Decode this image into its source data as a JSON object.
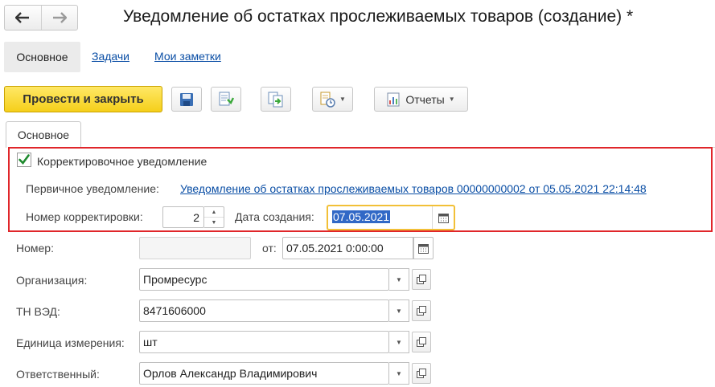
{
  "window": {
    "title": "Уведомление об остатках прослеживаемых товаров (создание) *"
  },
  "nav": {
    "back_icon": "arrow-left-icon",
    "forward_icon": "arrow-right-icon"
  },
  "section_tabs": [
    {
      "label": "Основное",
      "active": true
    },
    {
      "label": "Задачи",
      "active": false
    },
    {
      "label": "Мои заметки",
      "active": false
    }
  ],
  "toolbar": {
    "post_close_label": "Провести и закрыть",
    "save_icon": "floppy-disk-icon",
    "post_icon": "post-document-icon",
    "create_based_icon": "create-based-on-icon",
    "history_icon": "document-history-icon",
    "reports_label": "Отчеты",
    "accent_color": "#f5cf1a"
  },
  "form_tabs": [
    {
      "label": "Основное",
      "active": true
    }
  ],
  "correction": {
    "checkbox_label": "Корректировочное уведомление",
    "checked": true,
    "primary_label": "Первичное уведомление:",
    "primary_link": "Уведомление об остатках прослеживаемых товаров 00000000002 от 05.05.2021 22:14:48",
    "number_label": "Номер корректировки:",
    "number_value": "2",
    "date_label": "Дата создания:",
    "date_value": "07.05.2021",
    "highlight_color": "#e0262a"
  },
  "fields": {
    "number_label": "Номер:",
    "number_value": "",
    "from_label": "от:",
    "from_value": "07.05.2021  0:00:00",
    "organization_label": "Организация:",
    "organization_value": "Промресурс",
    "tnved_label": "ТН ВЭД:",
    "tnved_value": "8471606000",
    "unit_label": "Единица измерения:",
    "unit_value": "шт",
    "responsible_label": "Ответственный:",
    "responsible_value": "Орлов Александр Владимирович"
  }
}
